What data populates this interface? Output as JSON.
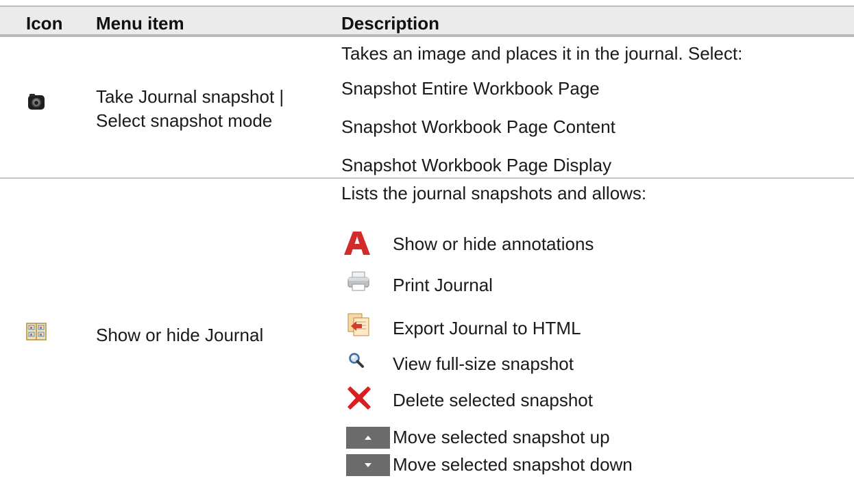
{
  "header": {
    "icon": "Icon",
    "menu_item": "Menu item",
    "description": "Description"
  },
  "row1": {
    "icon": "camera-icon",
    "menu_item_line1": "Take Journal snapshot |",
    "menu_item_line2": "Select snapshot mode",
    "desc_intro": "Takes an image and places it in the journal. Select:",
    "options": [
      "Snapshot Entire Workbook Page",
      "Snapshot Workbook Page Content",
      "Snapshot Workbook Page Display"
    ]
  },
  "row2": {
    "icon": "journal-book-icon",
    "menu_item": "Show or hide Journal",
    "desc_intro": "Lists the journal snapshots and allows:",
    "actions": [
      {
        "icon": "annotation-a-icon",
        "label": "Show or hide annotations"
      },
      {
        "icon": "printer-icon",
        "label": "Print Journal"
      },
      {
        "icon": "export-html-icon",
        "label": "Export Journal to HTML"
      },
      {
        "icon": "magnifier-icon",
        "label": "View full-size snapshot"
      },
      {
        "icon": "delete-x-icon",
        "label": "Delete selected snapshot"
      },
      {
        "icon": "arrow-up-icon",
        "label": "Move selected snapshot up"
      },
      {
        "icon": "arrow-down-icon",
        "label": "Move selected snapshot down"
      }
    ]
  },
  "colors": {
    "header_bg": "#ebebeb",
    "annotation_red": "#d32a2a",
    "delete_red": "#d81e1e",
    "arrow_button": "#6b6b6b"
  }
}
